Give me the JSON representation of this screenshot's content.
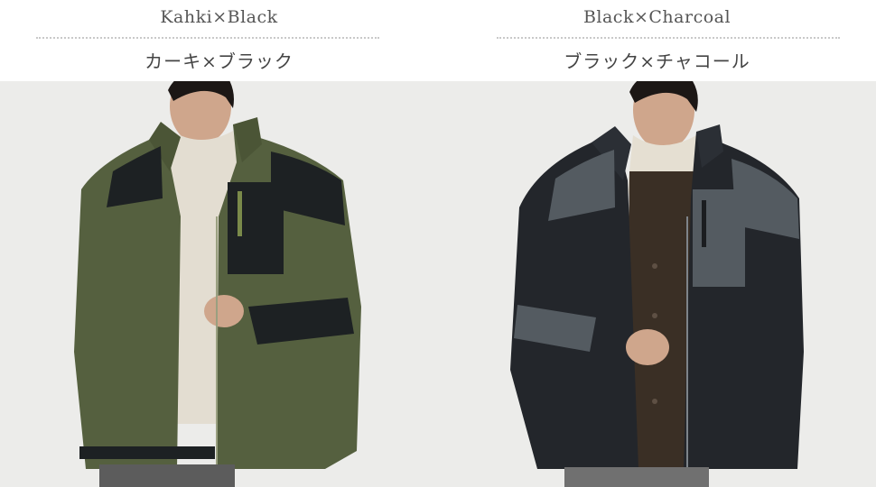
{
  "panels": [
    {
      "label_en": "Kahki×Black",
      "label_ja": "カーキ×ブラック",
      "photo_alt": "",
      "colors": {
        "body": "#55603f",
        "panel": "#1d2123",
        "inner": "#e3ddd1",
        "pants": "#5c5c5c"
      }
    },
    {
      "label_en": "Black×Charcoal",
      "label_ja": "ブラック×チャコール",
      "photo_alt": "",
      "colors": {
        "body": "#23262b",
        "panel": "#545b61",
        "inner": "#e5dfd2",
        "shirt": "#3a2f25",
        "pants": "#707070"
      }
    }
  ]
}
